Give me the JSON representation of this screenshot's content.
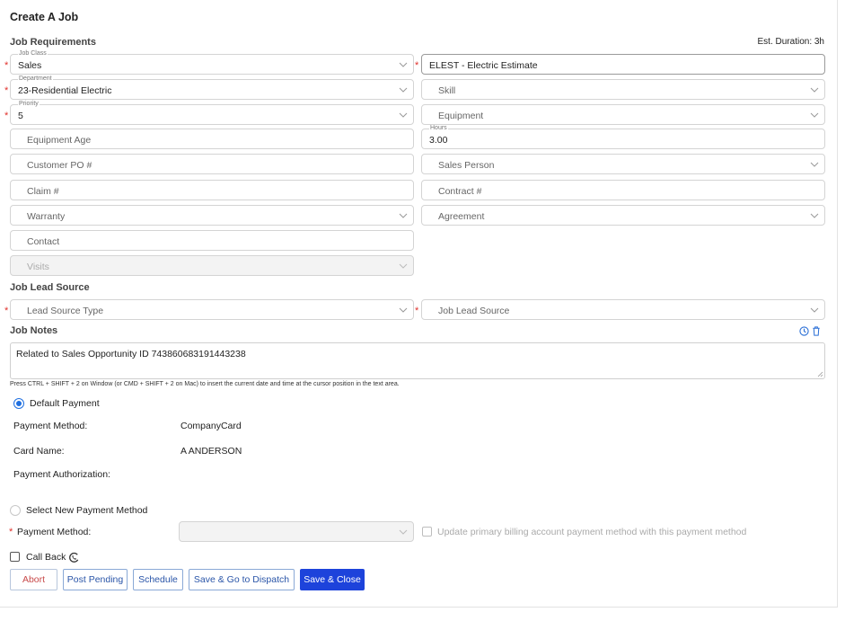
{
  "header": {
    "title": "Create A Job"
  },
  "requirements": {
    "section_title": "Job Requirements",
    "est_duration": "Est. Duration: 3h",
    "job_class": {
      "label": "Job Class",
      "value": "Sales"
    },
    "job_type": {
      "value": "ELEST - Electric Estimate"
    },
    "department": {
      "label": "Department",
      "value": "23-Residential Electric"
    },
    "skill": {
      "placeholder": "Skill"
    },
    "priority": {
      "label": "Priority",
      "value": "5"
    },
    "equipment": {
      "placeholder": "Equipment"
    },
    "equipment_age": {
      "placeholder": "Equipment Age"
    },
    "hours": {
      "label": "Hours",
      "value": "3.00"
    },
    "customer_po": {
      "placeholder": "Customer PO #"
    },
    "sales_person": {
      "placeholder": "Sales Person"
    },
    "claim": {
      "placeholder": "Claim #"
    },
    "contract": {
      "placeholder": "Contract #"
    },
    "warranty": {
      "placeholder": "Warranty"
    },
    "agreement": {
      "placeholder": "Agreement"
    },
    "contact": {
      "placeholder": "Contact"
    },
    "visits": {
      "placeholder": "Visits"
    }
  },
  "lead_source": {
    "section_title": "Job Lead Source",
    "lead_source_type": {
      "placeholder": "Lead Source Type"
    },
    "job_lead_source": {
      "placeholder": "Job Lead Source"
    }
  },
  "notes": {
    "section_title": "Job Notes",
    "value": "Related to Sales Opportunity ID 743860683191443238",
    "hint": "Press CTRL + SHIFT + 2 on Window (or CMD + SHIFT + 2 on Mac) to insert the current date and time at the cursor position in the text area."
  },
  "payment": {
    "default_label": "Default Payment",
    "method_label": "Payment Method:",
    "method_value": "CompanyCard",
    "card_name_label": "Card Name:",
    "card_name_value": "A ANDERSON",
    "authorization_label": "Payment Authorization:",
    "select_new_label": "Select New Payment Method",
    "new_method_label": "Payment Method:",
    "update_primary_label": "Update primary billing account payment method with this payment method"
  },
  "callback": {
    "label": "Call Back"
  },
  "actions": {
    "abort": "Abort",
    "post_pending": "Post Pending",
    "schedule": "Schedule",
    "save_dispatch": "Save & Go to Dispatch",
    "save_close": "Save & Close"
  },
  "colors": {
    "primary": "#1d43db",
    "required": "#e0312b",
    "radio_accent": "#1f6fe0"
  },
  "icons": [
    "chevron-down-icon",
    "history-icon",
    "trash-icon",
    "callback-icon"
  ]
}
